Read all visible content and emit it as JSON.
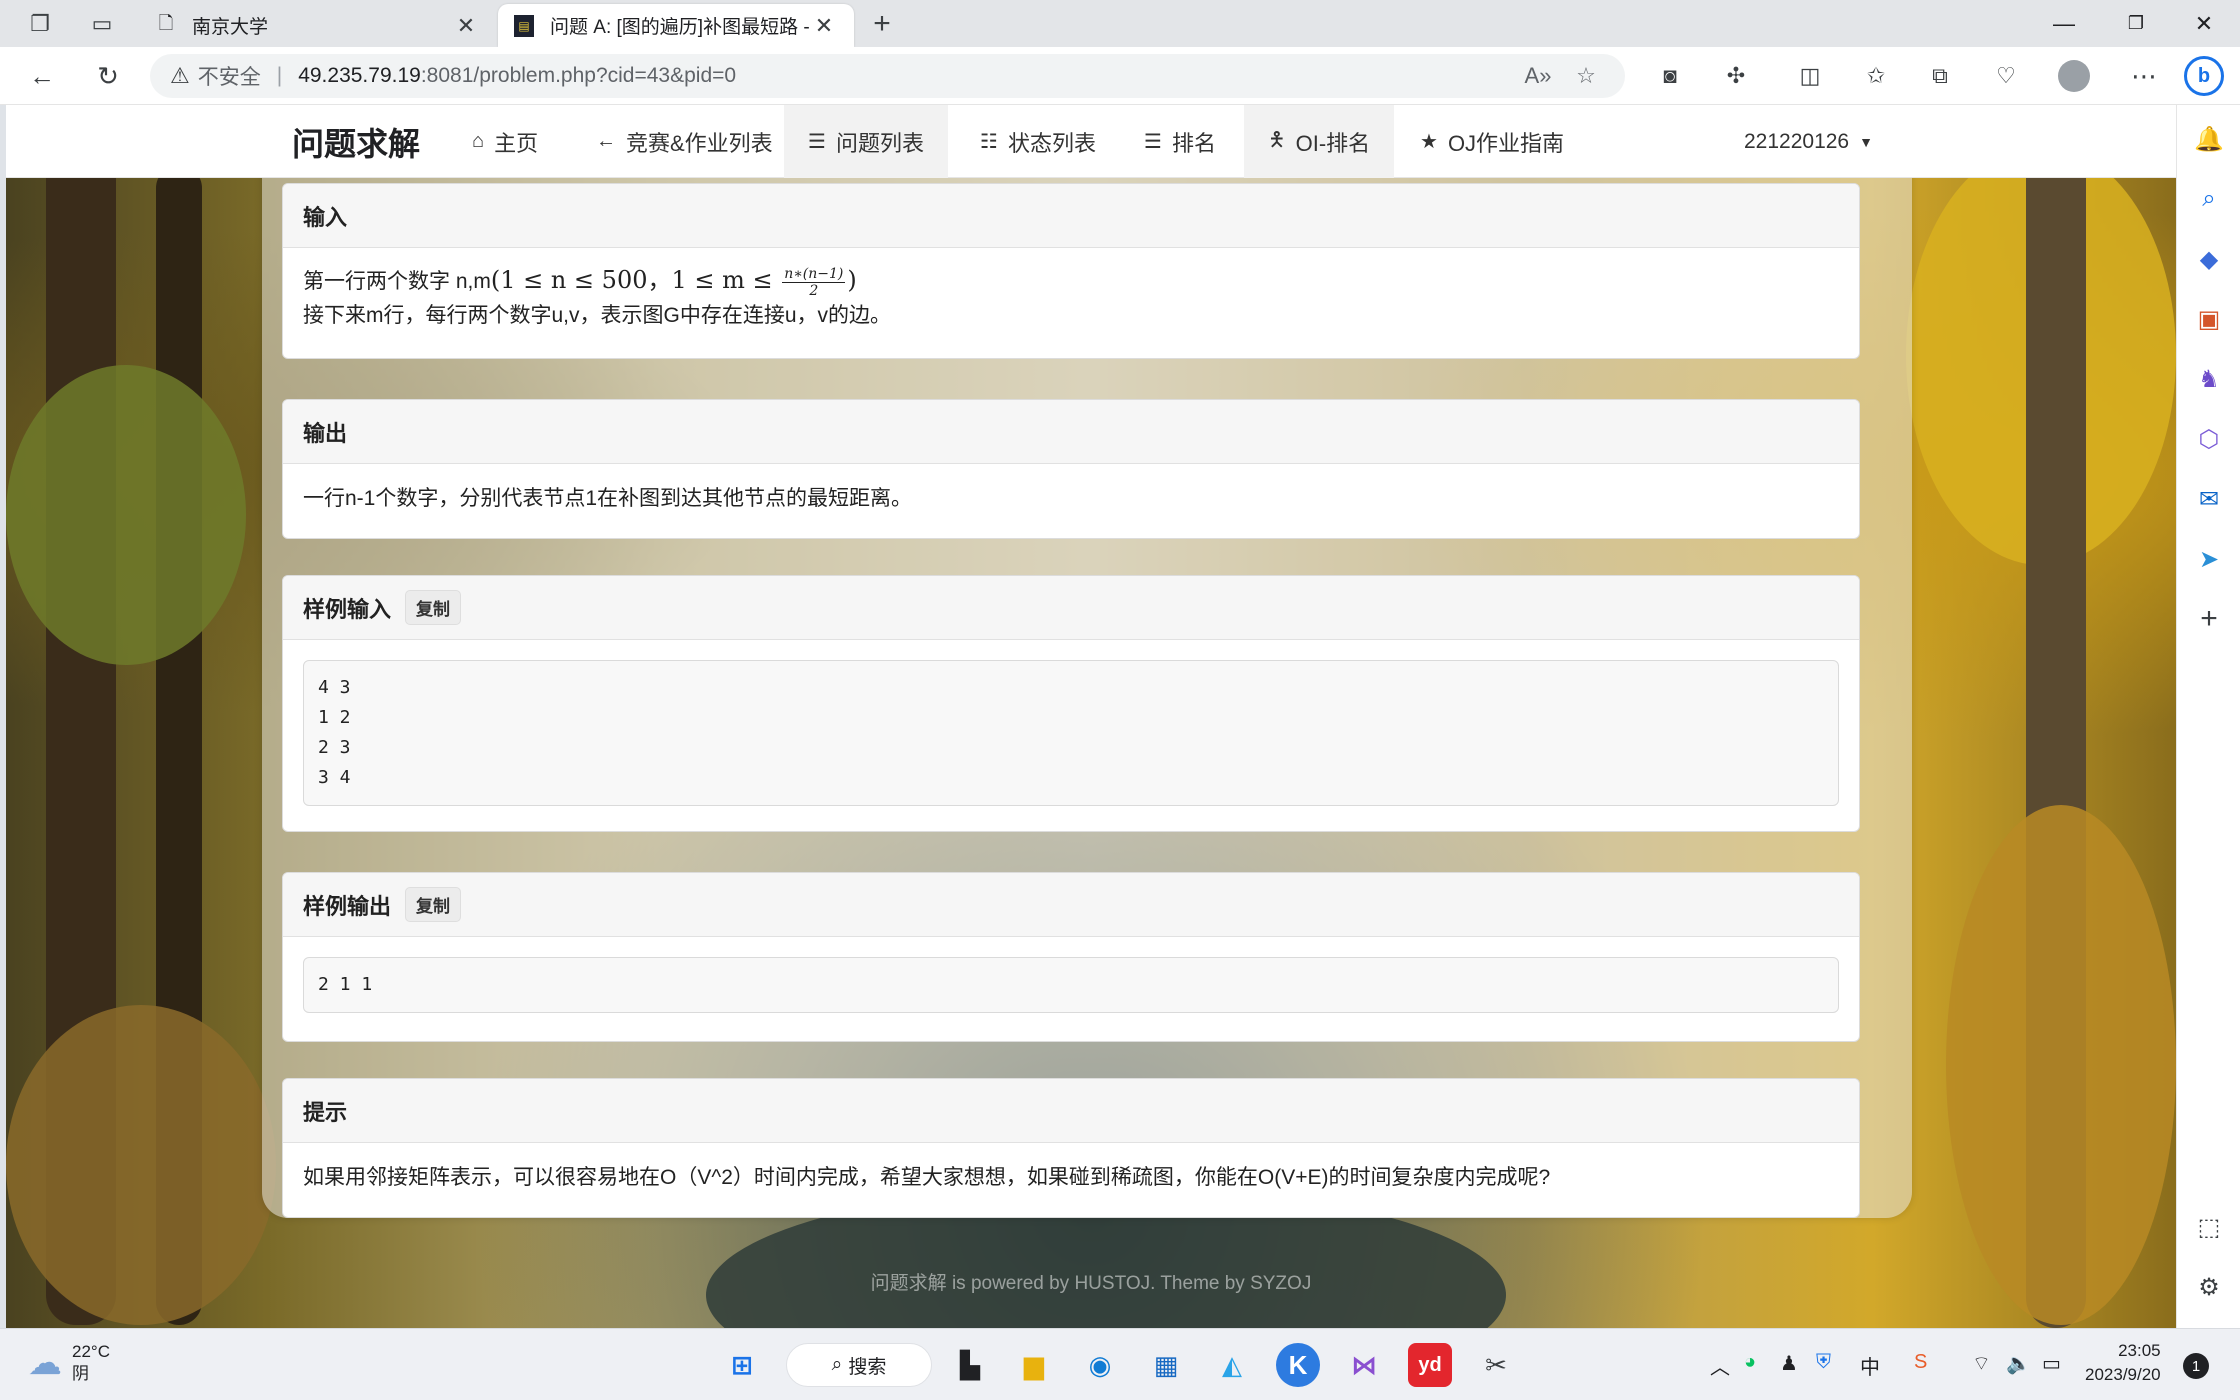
{
  "browser": {
    "tabs": [
      {
        "title": "南京大学",
        "active": false
      },
      {
        "title": "问题 A: [图的遍历]补图最短路 - |",
        "active": true
      }
    ],
    "address": {
      "insecure_label": "不安全",
      "host": "49.235.79.19",
      "rest": ":8081/problem.php?cid=43&pid=0"
    }
  },
  "navbar": {
    "brand": "问题求解",
    "items": [
      {
        "label": "主页",
        "icon": "home-icon"
      },
      {
        "label": "竞赛&作业列表",
        "icon": "arrow-left-icon"
      },
      {
        "label": "问题列表",
        "icon": "list-icon"
      },
      {
        "label": "状态列表",
        "icon": "tasks-icon"
      },
      {
        "label": "排名",
        "icon": "list-ol-icon"
      },
      {
        "label": "OI-排名",
        "icon": "child-icon"
      },
      {
        "label": "OJ作业指南",
        "icon": "star-icon"
      }
    ],
    "user": "221220126"
  },
  "sections": {
    "input": {
      "title": "输入",
      "line1_prefix": "第一行两个数字 n,m",
      "line1_math_a": "(1 ≤ n ≤ 500，1 ≤ m ≤ ",
      "frac_num": "n∗(n−1)",
      "frac_den": "2",
      "line1_math_b": ")",
      "line2": "接下来m行，每行两个数字u,v，表示图G中存在连接u，v的边。"
    },
    "output": {
      "title": "输出",
      "text": "一行n-1个数字，分别代表节点1在补图到达其他节点的最短距离。"
    },
    "sample_input": {
      "title": "样例输入",
      "copy": "复制",
      "code": "4 3\n1 2\n2 3\n3 4"
    },
    "sample_output": {
      "title": "样例输出",
      "copy": "复制",
      "code": "2 1 1"
    },
    "hint": {
      "title": "提示",
      "text": "如果用邻接矩阵表示，可以很容易地在O（V^2）时间内完成，希望大家想想，如果碰到稀疏图，你能在O(V+E)的时间复杂度内完成呢?"
    }
  },
  "footer": "问题求解 is powered by HUSTOJ. Theme by SYZOJ",
  "taskbar": {
    "weather_temp": "22°C",
    "weather_desc": "阴",
    "search": "搜索",
    "ime": "中",
    "time": "23:05",
    "date": "2023/9/20",
    "notifications": "1"
  }
}
